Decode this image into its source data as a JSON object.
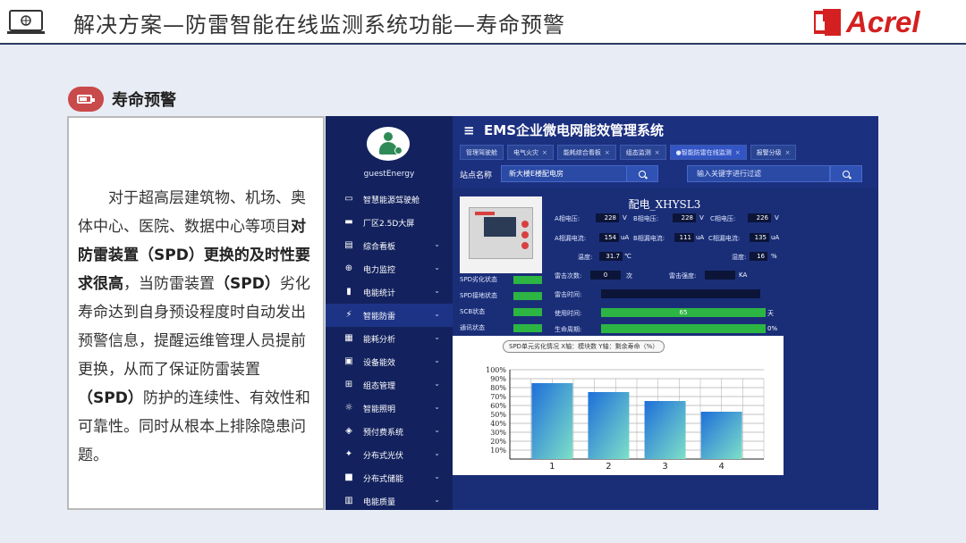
{
  "header": {
    "title": "解决方案—防雷智能在线监测系统功能—寿命预警",
    "logo_text": "Acrel"
  },
  "section": {
    "title": "寿命预警"
  },
  "description": {
    "p1": "对于超高层建筑物、机场、奥体中心、医院、数据中心等项目",
    "bold1": "对防雷装置（SPD）更换的及时性要求很高",
    "p2": "，当防雷装置",
    "bold2": "（SPD）",
    "p3": "劣化寿命达到自身预设程度时自动发出预警信息，提醒运维管理人员提前更换，从而了保证防雷装置",
    "bold3": "（SPD）",
    "p4": "防护的连续性、有效性和可靠性。同时从根本上排除隐患问题。"
  },
  "app": {
    "title": "EMS企业微电网能效管理系统",
    "username": "guestEnergy",
    "menu": [
      {
        "icon": "dashboard-icon",
        "label": "智慧能源驾驶舱",
        "caret": false
      },
      {
        "icon": "screen-icon",
        "label": "厂区2.5D大屏",
        "caret": false
      },
      {
        "icon": "chart-board-icon",
        "label": "综合看板",
        "caret": true
      },
      {
        "icon": "power-monitor-icon",
        "label": "电力监控",
        "caret": true
      },
      {
        "icon": "bar-stats-icon",
        "label": "电能统计",
        "caret": true
      },
      {
        "icon": "lightning-protect-icon",
        "label": "智能防雷",
        "caret": true
      },
      {
        "icon": "energy-analysis-icon",
        "label": "能耗分析",
        "caret": true
      },
      {
        "icon": "device-energy-icon",
        "label": "设备能效",
        "caret": true
      },
      {
        "icon": "config-icon",
        "label": "组态管理",
        "caret": true
      },
      {
        "icon": "lighting-icon",
        "label": "智能照明",
        "caret": true
      },
      {
        "icon": "prepaid-icon",
        "label": "预付费系统",
        "caret": true
      },
      {
        "icon": "solar-icon",
        "label": "分布式光伏",
        "caret": true
      },
      {
        "icon": "storage-icon",
        "label": "分布式储能",
        "caret": true
      },
      {
        "icon": "power-quality-icon",
        "label": "电能质量",
        "caret": true
      }
    ],
    "active_menu": "智能防雷",
    "tabs": [
      {
        "label": "管理驾驶舱",
        "close": false
      },
      {
        "label": "电气火灾",
        "close": true
      },
      {
        "label": "能耗综合看板",
        "close": true
      },
      {
        "label": "组态监测",
        "close": true
      },
      {
        "label": "●智能防雷在线监测",
        "close": true
      },
      {
        "label": "报警分级",
        "close": true
      }
    ],
    "station_label": "站点名称",
    "station_value": "新大楼E楼配电房",
    "filter_placeholder": "输入关键字进行过滤",
    "device_name": "配电_XHYSL3",
    "readings": {
      "va_label": "A相电压:",
      "va": "228",
      "va_unit": "V",
      "vb_label": "B相电压:",
      "vb": "228",
      "vb_unit": "V",
      "vc_label": "C相电压:",
      "vc": "226",
      "vc_unit": "V",
      "ia_label": "A相漏电流:",
      "ia": "154",
      "ia_unit": "uA",
      "ib_label": "B相漏电流:",
      "ib": "111",
      "ib_unit": "uA",
      "ic_label": "C相漏电流:",
      "ic": "135",
      "ic_unit": "uA",
      "temp_label": "温度:",
      "temp": "31.7",
      "temp_unit": "℃",
      "hum_label": "湿度:",
      "hum": "16",
      "hum_unit": "%",
      "strikes_label": "雷击次数:",
      "strikes": "0",
      "strikes_unit": "次",
      "intensity_label": "雷击强度:",
      "intensity": "",
      "intensity_unit": "KA",
      "strike_time_label": "雷击时间:",
      "use_time_label": "使用时间:",
      "use_time": "65",
      "use_time_unit": "天",
      "life_label": "生命周期:",
      "life_value": "0%"
    },
    "status": [
      {
        "label": "SPD劣化状态"
      },
      {
        "label": "SPD接地状态"
      },
      {
        "label": "SCB状态"
      },
      {
        "label": "通讯状态"
      }
    ]
  },
  "chart_data": {
    "type": "bar",
    "title": "SPD单元劣化情况  X轴：模块数  Y轴：剩余寿命（%）",
    "categories": [
      "1",
      "2",
      "3",
      "4"
    ],
    "values": [
      85,
      75,
      65,
      53
    ],
    "ylim": [
      0,
      100
    ],
    "yticks": [
      "10%",
      "20%",
      "30%",
      "40%",
      "50%",
      "60%",
      "70%",
      "80%",
      "90%",
      "100%"
    ],
    "grid": true,
    "bar_color_top": "#1e6fd9",
    "bar_color_bottom": "#7ee0c8"
  }
}
